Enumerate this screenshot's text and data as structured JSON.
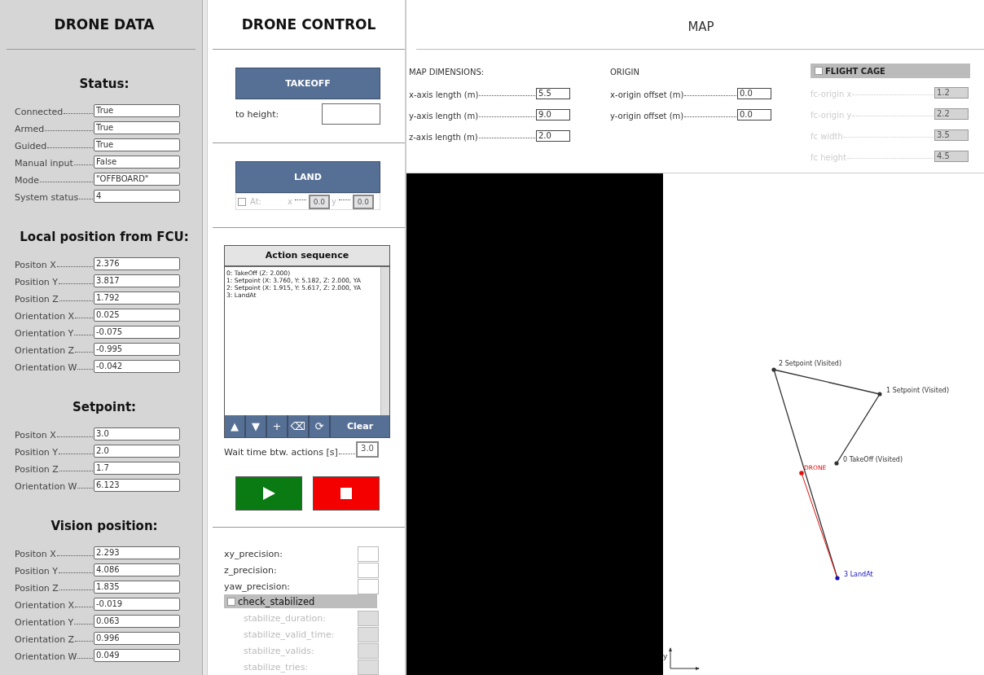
{
  "drone_data": {
    "title": "DRONE DATA",
    "sections": [
      {
        "heading": "Status:",
        "fields": [
          {
            "label": "Connected",
            "value": "True"
          },
          {
            "label": "Armed",
            "value": "True"
          },
          {
            "label": "Guided",
            "value": "True"
          },
          {
            "label": "Manual input",
            "value": "False"
          },
          {
            "label": "Mode",
            "value": "\"OFFBOARD\""
          },
          {
            "label": "System status",
            "value": "4"
          }
        ]
      },
      {
        "heading": "Local position from FCU:",
        "fields": [
          {
            "label": "Positon X",
            "value": "2.376"
          },
          {
            "label": "Position Y",
            "value": "3.817"
          },
          {
            "label": "Position Z",
            "value": "1.792"
          },
          {
            "label": "Orientation X",
            "value": "0.025"
          },
          {
            "label": "Orientation Y",
            "value": "-0.075"
          },
          {
            "label": "Orientation Z",
            "value": "-0.995"
          },
          {
            "label": "Orientation W",
            "value": "-0.042"
          }
        ]
      },
      {
        "heading": "Setpoint:",
        "fields": [
          {
            "label": "Positon X",
            "value": "3.0"
          },
          {
            "label": "Position Y",
            "value": "2.0"
          },
          {
            "label": "Position Z",
            "value": "1.7"
          },
          {
            "label": "Orientation W",
            "value": "6.123"
          }
        ]
      },
      {
        "heading": "Vision position:",
        "fields": [
          {
            "label": "Positon X",
            "value": "2.293"
          },
          {
            "label": "Position Y",
            "value": "4.086"
          },
          {
            "label": "Position Z",
            "value": "1.835"
          },
          {
            "label": "Orientation X",
            "value": "-0.019"
          },
          {
            "label": "Orientation Y",
            "value": "0.063"
          },
          {
            "label": "Orientation Z",
            "value": "0.996"
          },
          {
            "label": "Orientation W",
            "value": "0.049"
          }
        ]
      }
    ]
  },
  "drone_control": {
    "title": "DRONE CONTROL",
    "takeoff": {
      "button": "TAKEOFF",
      "height_label": "to height:"
    },
    "land": {
      "button": "LAND",
      "at_label": "At:",
      "checked": false,
      "disabled": true,
      "x_label": "x",
      "x_value": "0.0",
      "y_label": "y",
      "y_value": "0.0"
    },
    "action_sequence": {
      "title": "Action sequence",
      "items": [
        {
          "text": "0: TakeOff (Z:  2.000)"
        },
        {
          "text": "1: Setpoint (X: 3.760, Y: 5.182, Z: 2.000, YA"
        },
        {
          "text": "2: Setpoint (X: 1.915, Y: 5.617, Z: 2.000, YA"
        },
        {
          "text": "3: LandAt"
        }
      ],
      "tools": [
        {
          "kind": "up",
          "label": "▲"
        },
        {
          "kind": "down",
          "label": "▼"
        },
        {
          "kind": "add",
          "label": "+"
        },
        {
          "kind": "delete",
          "label": "⌫"
        },
        {
          "kind": "reload",
          "label": "⟳"
        },
        {
          "kind": "clear",
          "label": "Clear"
        }
      ],
      "wait_label": "Wait time btw. actions [s]",
      "wait_value": "3.0"
    },
    "precision": [
      {
        "label": "xy_precision:",
        "disabled": false
      },
      {
        "label": "z_precision:",
        "disabled": false
      },
      {
        "label": "yaw_precision:",
        "disabled": false
      }
    ],
    "check_stabilized": {
      "label": "check_stabilized",
      "checked": false
    },
    "stabilize": [
      {
        "label": "stabilize_duration:",
        "disabled": true
      },
      {
        "label": "stabilize_valid_time:",
        "disabled": true
      },
      {
        "label": "stabilize_valids:",
        "disabled": true
      },
      {
        "label": "stabilize_tries:",
        "disabled": true
      }
    ]
  },
  "map": {
    "title": "MAP",
    "dimensions": {
      "heading": "MAP DIMENSIONS:",
      "fields": [
        {
          "label": "x-axis length (m)",
          "value": "5.5",
          "disabled": false
        },
        {
          "label": "y-axis length (m)",
          "value": "9.0",
          "disabled": false
        },
        {
          "label": "z-axis length (m)",
          "value": "2.0",
          "disabled": false
        }
      ]
    },
    "origin": {
      "heading": "ORIGIN",
      "fields": [
        {
          "label": "x-origin offset (m)",
          "value": "0.0",
          "disabled": false
        },
        {
          "label": "y-origin offset (m)",
          "value": "0.0",
          "disabled": false
        }
      ]
    },
    "flight_cage": {
      "heading": "FLIGHT CAGE",
      "checked": false,
      "fields": [
        {
          "label": "fc-origin x",
          "value": "1.2",
          "disabled": true
        },
        {
          "label": "fc-origin y",
          "value": "2.2",
          "disabled": true
        },
        {
          "label": "fc width",
          "value": "3.5",
          "disabled": true
        },
        {
          "label": "fc height",
          "value": "4.5",
          "disabled": true
        }
      ]
    },
    "waypoints": [
      {
        "label": "0 TakeOff (Visited)",
        "color": "#333333"
      },
      {
        "label": "1 Setpoint (Visited)",
        "color": "#333333"
      },
      {
        "label": "2 Setpoint (Visited)",
        "color": "#333333"
      },
      {
        "label": "3 LandAt",
        "color": "#1010c0"
      }
    ],
    "drone": {
      "label": "DRONE",
      "color": "#e01010"
    },
    "axis_label": "y"
  }
}
